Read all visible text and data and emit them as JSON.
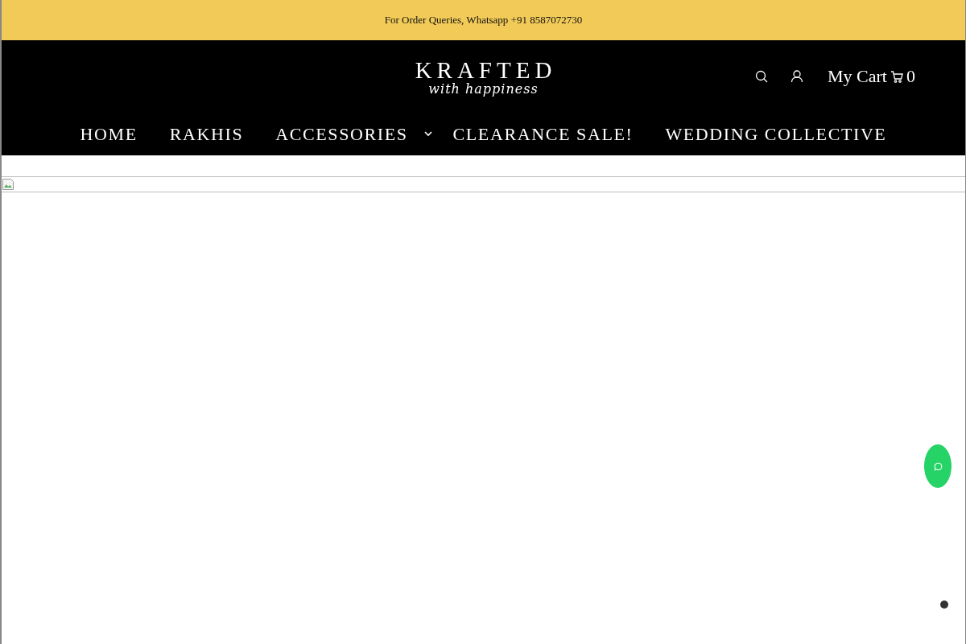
{
  "announcement": "For Order Queries, Whatsapp +91 8587072730",
  "logo": {
    "title": "KRAFTED",
    "tagline": "with happiness"
  },
  "header_actions": {
    "cart_label": "My Cart",
    "cart_count": "0"
  },
  "nav": [
    {
      "label": "HOME",
      "has_dropdown": false
    },
    {
      "label": "RAKHIS",
      "has_dropdown": false
    },
    {
      "label": "ACCESSORIES",
      "has_dropdown": true
    },
    {
      "label": "CLEARANCE SALE!",
      "has_dropdown": false
    },
    {
      "label": "WEDDING COLLECTIVE",
      "has_dropdown": false
    }
  ],
  "slider_dots": [
    {
      "selected": true
    }
  ]
}
